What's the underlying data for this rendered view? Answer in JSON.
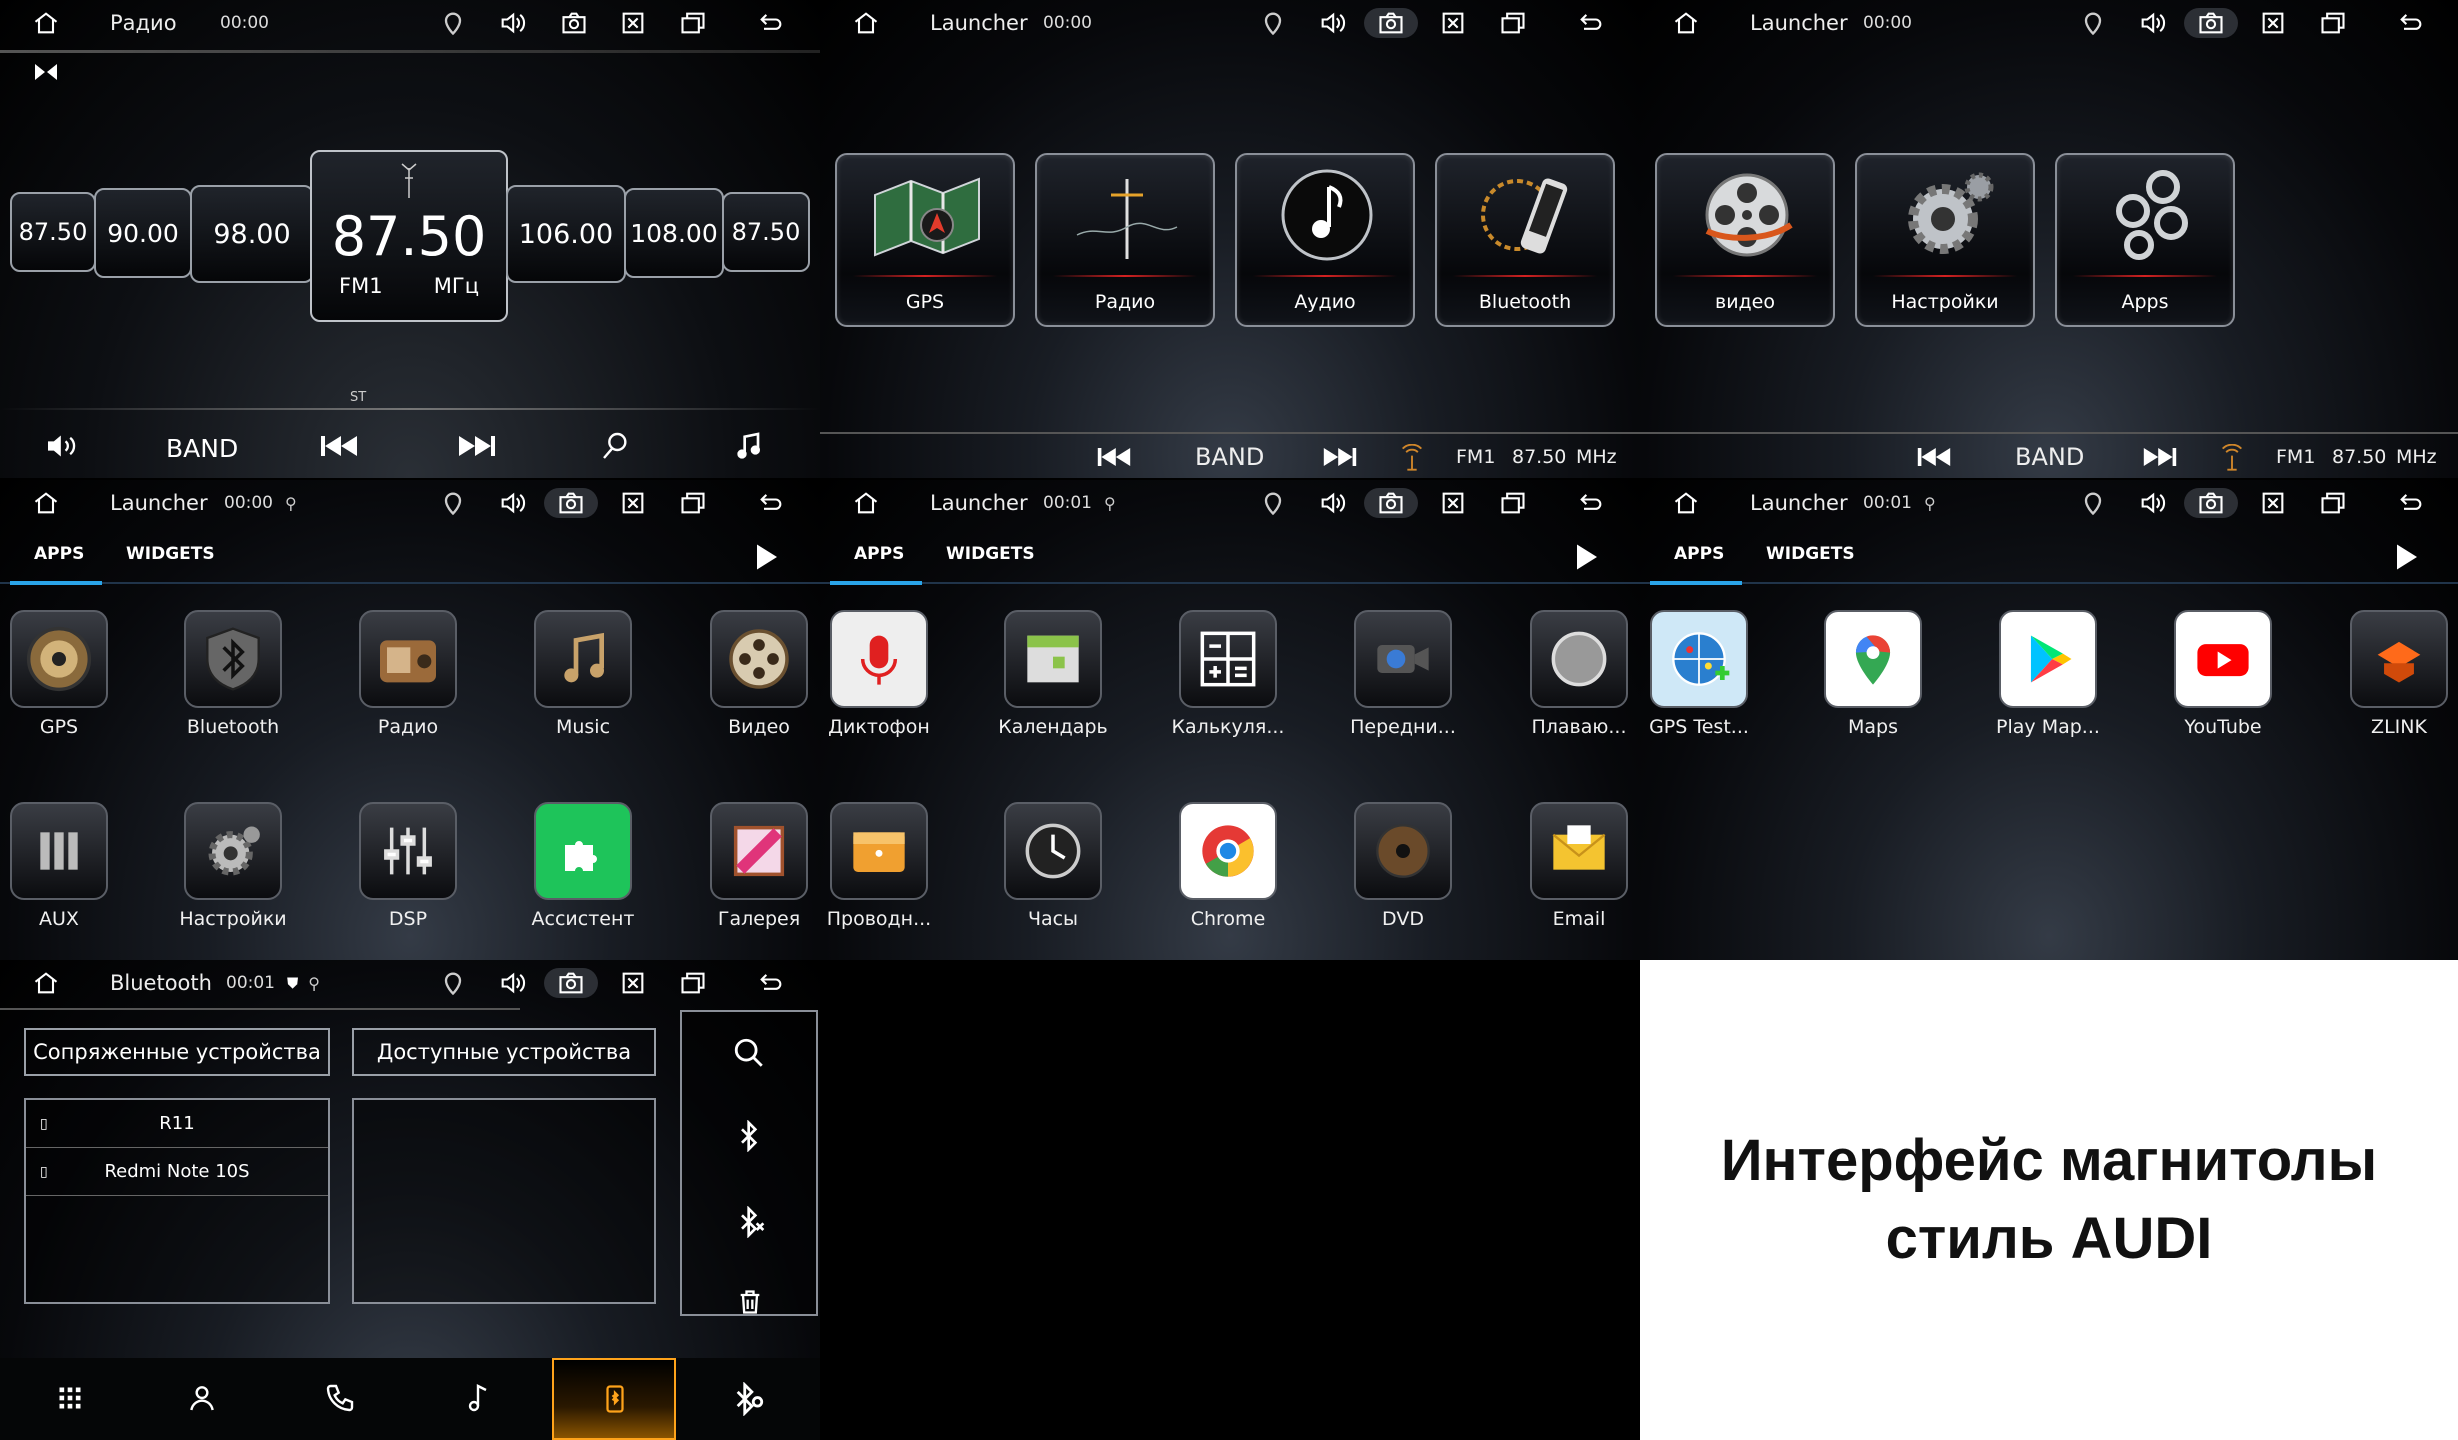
{
  "colors": {
    "accent": "#2aa4e8",
    "red": "#d52121",
    "bt_active": "#ffa31a"
  },
  "radio": {
    "title": "Радио",
    "clock": "00:00",
    "freqs": [
      "87.50",
      "90.00",
      "98.00",
      "106.00",
      "108.00",
      "87.50"
    ],
    "main": {
      "freq": "87.50",
      "band": "FM1",
      "unit": "МГц"
    },
    "st": "ST",
    "band": "BAND"
  },
  "launcher1": {
    "title": "Launcher",
    "clock": "00:00",
    "tiles": [
      {
        "label": "GPS",
        "icon": "map-icon"
      },
      {
        "label": "Радио",
        "icon": "antenna-icon"
      },
      {
        "label": "Аудио",
        "icon": "music-note-icon"
      },
      {
        "label": "Bluetooth",
        "icon": "phone-icon"
      }
    ],
    "band": "BAND",
    "fm": "FM1",
    "freq": "87.50",
    "unit": "MHz"
  },
  "launcher2": {
    "title": "Launcher",
    "clock": "00:00",
    "tiles": [
      {
        "label": "видео",
        "icon": "film-reel-icon"
      },
      {
        "label": "Настройки",
        "icon": "gear-icon"
      },
      {
        "label": "Apps",
        "icon": "circles-icon"
      }
    ],
    "band": "BAND",
    "fm": "FM1",
    "freq": "87.50",
    "unit": "MHz"
  },
  "apps1": {
    "title": "Launcher",
    "clock": "00:00",
    "tabs": [
      "APPS",
      "WIDGETS"
    ],
    "apps": [
      "GPS",
      "Bluetooth",
      "Радио",
      "Music",
      "Видео",
      "AUX",
      "Настройки",
      "DSP",
      "Ассистент",
      "Галерея"
    ]
  },
  "apps2": {
    "title": "Launcher",
    "clock": "00:01",
    "tabs": [
      "APPS",
      "WIDGETS"
    ],
    "apps": [
      "Диктофон",
      "Календарь",
      "Калькуля...",
      "Передни...",
      "Плаваю...",
      "Проводн...",
      "Часы",
      "Chrome",
      "DVD",
      "Email"
    ]
  },
  "apps3": {
    "title": "Launcher",
    "clock": "00:01",
    "tabs": [
      "APPS",
      "WIDGETS"
    ],
    "apps": [
      "GPS Test...",
      "Maps",
      "Play Map...",
      "YouTube",
      "ZLINK"
    ]
  },
  "bt": {
    "title": "Bluetooth",
    "clock": "00:01",
    "paired_hdr": "Сопряженные устройства",
    "avail_hdr": "Доступные устройства",
    "devices": [
      "R11",
      "Redmi Note 10S"
    ]
  },
  "caption": {
    "line1": "Интерфейс магнитолы",
    "line2": "стиль AUDI"
  }
}
